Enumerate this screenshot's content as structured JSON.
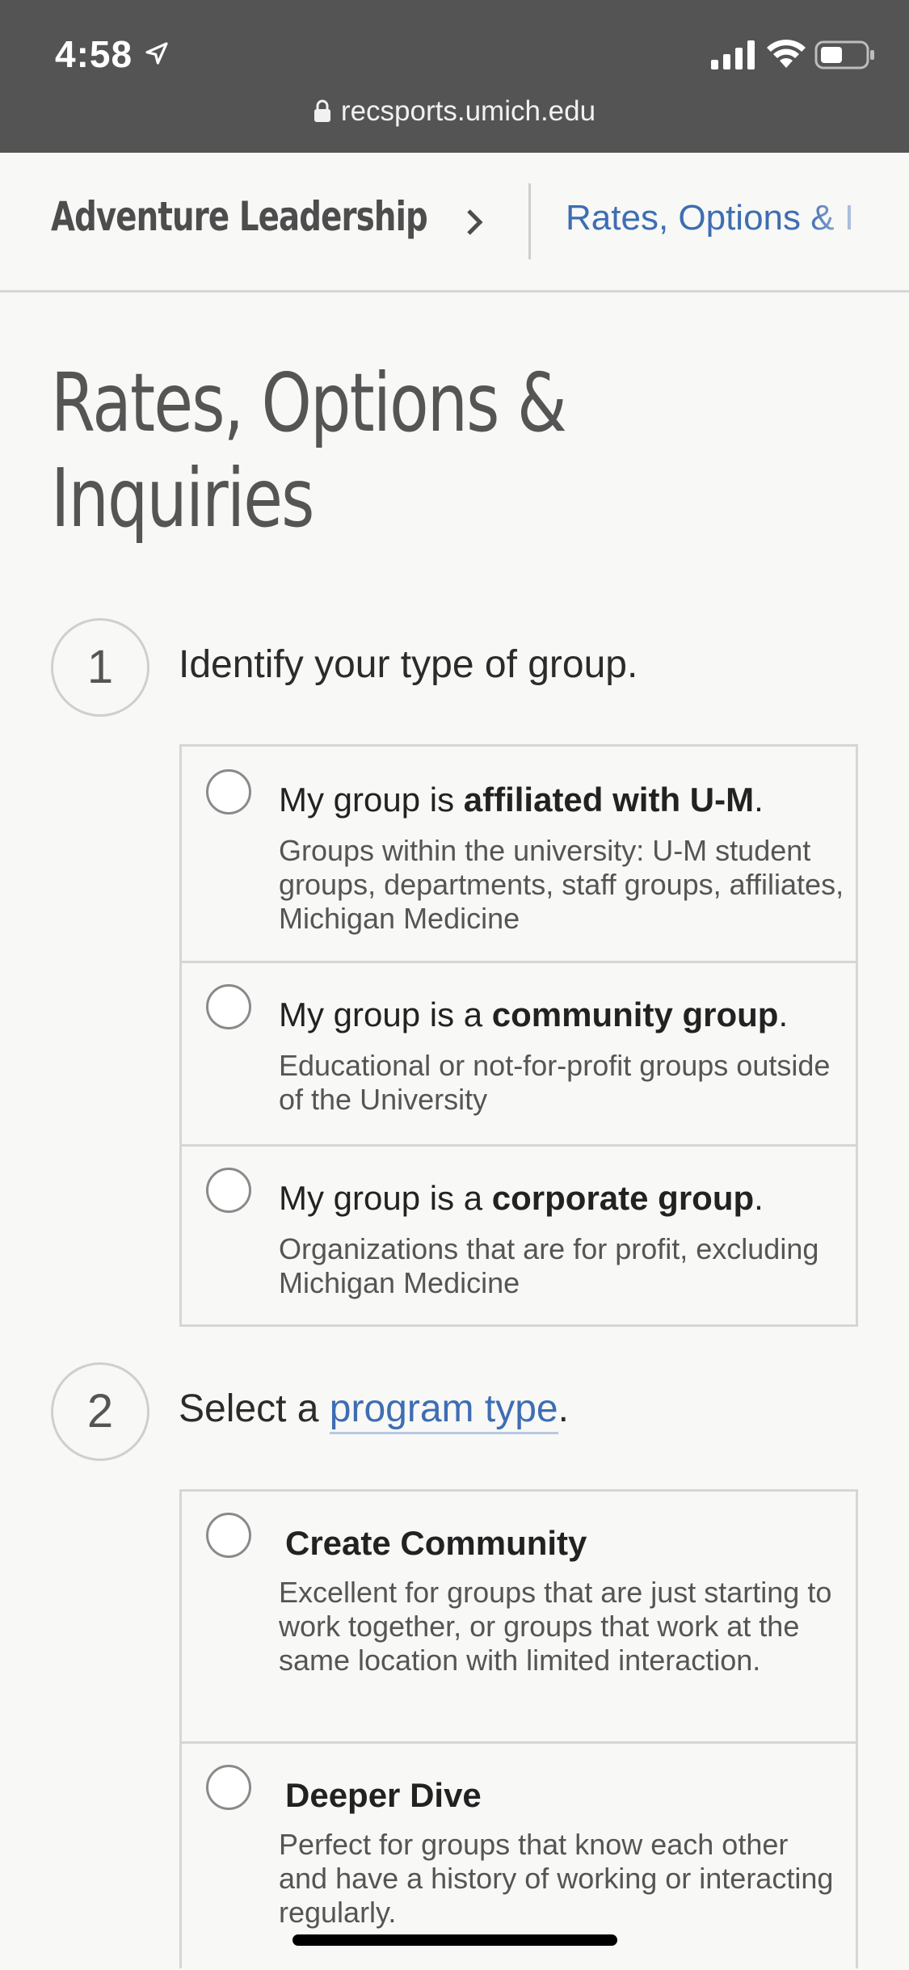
{
  "status_bar": {
    "time": "4:58",
    "url": "recsports.umich.edu",
    "icons": [
      "location-arrow-icon",
      "signal-icon",
      "wifi-icon",
      "battery-icon",
      "lock-icon"
    ]
  },
  "breadcrumb": {
    "parent": "Adventure Leadership",
    "current": "Rates, Options & Inquiries"
  },
  "page": {
    "title_line1": "Rates, Options &",
    "title_line2": "Inquiries"
  },
  "step1": {
    "number": "1",
    "label": "Identify your type of group.",
    "options": [
      {
        "prefix": "My group is ",
        "bold": "affiliated with U-M",
        "suffix": ".",
        "desc": "Groups within the university: U-M student groups, departments, staff groups, affiliates, Michigan Medicine"
      },
      {
        "prefix": "My group is a ",
        "bold": "community group",
        "suffix": ".",
        "desc": "Educational or not-for-profit groups outside of the University"
      },
      {
        "prefix": "My group is a ",
        "bold": "corporate group",
        "suffix": ".",
        "desc": "Organizations that are for profit, excluding Michigan Medicine"
      }
    ]
  },
  "step2": {
    "number": "2",
    "label_prefix": "Select a ",
    "label_link": "program type",
    "label_suffix": ".",
    "programs": [
      {
        "title": "Create Community",
        "desc": "Excellent for groups that are just starting to work together, or groups that work at the same location with limited interaction."
      },
      {
        "title": "Deeper Dive",
        "desc": "Perfect for groups that know each other and have a history of working or interacting regularly."
      }
    ]
  },
  "colors": {
    "status_bar_bg": "#545454",
    "link": "#3e6db3",
    "page_bg": "#f8f8f6"
  }
}
